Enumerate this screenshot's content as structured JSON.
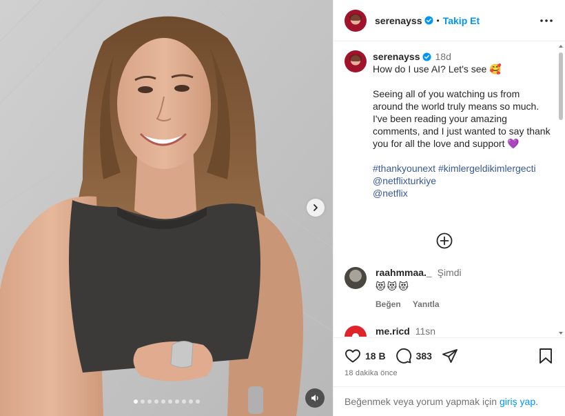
{
  "post": {
    "username": "serenayss",
    "follow_label": "Takip Et",
    "separator": "•",
    "time": "18d",
    "caption_line1": "How do I use AI? Let's see 🥰",
    "caption_para": "Seeing all of you watching us from around the world truly means so much. I've been reading your amazing comments, and I just wanted to say thank you for all the love and support 💜",
    "tags": [
      "#thankyounext",
      "#kimlergeldikimlergecti",
      "@netflixturkiye",
      "@netflix"
    ]
  },
  "comments": [
    {
      "username": "raahmmaa._",
      "time": "Şimdi",
      "text": "😻😻😻",
      "like_label": "Beğen",
      "reply_label": "Yanıtla"
    },
    {
      "username": "me.ricd",
      "time": "11sn"
    }
  ],
  "stats": {
    "likes": "18 B",
    "comments": "383",
    "posted": "18 dakika önce"
  },
  "footer": {
    "prefix": "Beğenmek veya yorum yapmak için",
    "login_label": "giriş yap."
  },
  "colors": {
    "accent": "#0095f6",
    "hashtag": "#385898",
    "muted": "#737373"
  },
  "carousel": {
    "slides": 10,
    "active": 0
  }
}
